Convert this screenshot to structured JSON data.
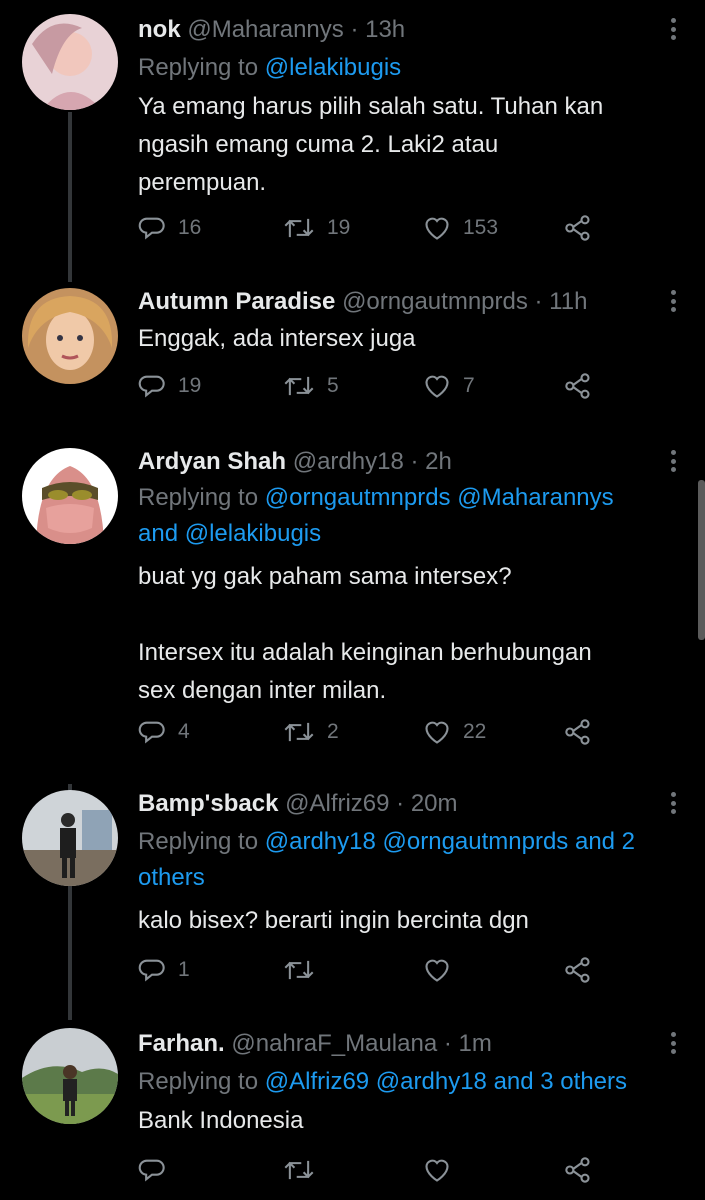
{
  "tweets": [
    {
      "name": "nok",
      "handle": "@Maharannys · 13h",
      "replying_prefix": "Replying to",
      "replying_mentions": "@lelakibugis",
      "replying_suffix": "",
      "text_lines": [
        "Ya emang harus pilih salah satu. Tuhan kan",
        "ngasih emang cuma 2. Laki2 atau",
        "perempuan."
      ],
      "replies": "16",
      "retweets": "19",
      "likes": "153"
    },
    {
      "name": "Autumn Paradise",
      "handle": "@orngautmnprds · 11h",
      "text_lines": [
        "Enggak, ada intersex juga"
      ],
      "replies": "19",
      "retweets": "5",
      "likes": "7"
    },
    {
      "name": "Ardyan Shah",
      "handle": "@ardhy18 · 2h",
      "replying_prefix": "Replying to",
      "replying_line1": "@orngautmnprds @Maharannys",
      "replying_line2": "and @lelakibugis",
      "text_lines": [
        "buat yg gak paham sama intersex?",
        "",
        "Intersex itu adalah keinginan berhubungan",
        "sex dengan inter milan."
      ],
      "replies": "4",
      "retweets": "2",
      "likes": "22"
    },
    {
      "name": "Bamp'sback",
      "handle": "@Alfriz69 · 20m",
      "replying_prefix": "Replying to",
      "replying_line1": "@ardhy18 @orngautmnprds and 2",
      "replying_line2": "others",
      "text_lines": [
        "kalo bisex? berarti ingin bercinta dgn"
      ],
      "replies": "1",
      "retweets": "",
      "likes": ""
    },
    {
      "name": "Farhan.",
      "handle": "@nahraF_Maulana · 1m",
      "replying_prefix": "Replying to",
      "replying_mentions": "@Alfriz69 @ardhy18 and 3 others",
      "text_lines": [
        "Bank Indonesia"
      ],
      "replies": "",
      "retweets": "",
      "likes": ""
    }
  ],
  "colors": {
    "background": "#000000",
    "name": "#e7e9ea",
    "secondary": "#71767b",
    "mention": "#1d9bf0",
    "thread_line": "#333639"
  },
  "icons": [
    "reply-icon",
    "retweet-icon",
    "like-icon",
    "share-icon",
    "more-icon"
  ]
}
